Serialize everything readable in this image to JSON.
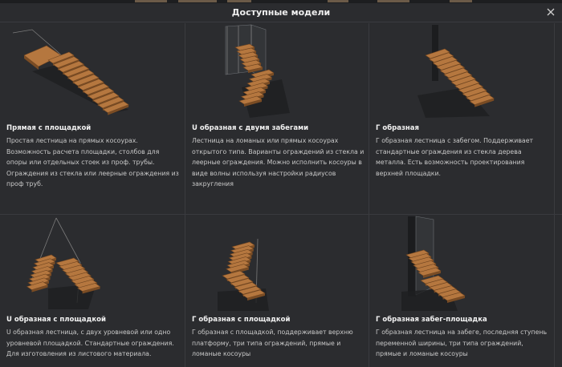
{
  "dialog": {
    "title": "Доступные модели"
  },
  "models": [
    {
      "title": "Прямая с площадкой",
      "description": "Простая лестница на прямых косоурах. Возможность расчета площадки, столбов для опоры или отдельных стоек из проф. трубы. Ограждения из стекла или леерные ограждения из проф труб."
    },
    {
      "title": "U образная с двумя забегами",
      "description": "Лестница на ломаных или прямых косоурах открытого типа. Варианты ограждений из стекла и леерные ограждения. Можно исполнить косоуры в виде волны используя настройки радиусов закругления"
    },
    {
      "title": "Г образная",
      "description": "Г образная лестница с забегом. Поддерживает стандартные ограждения из стекла дерева металла. Есть возможность проектирования верхней площадки."
    },
    {
      "title": "U образная с площадкой",
      "description": "U образная лестница, с двух уровневой или одно уровневой площадкой. Стандартные ограждения. Для изготовления из листового материала."
    },
    {
      "title": "Г образная с площадкой",
      "description": "Г образная с площадкой, поддерживает верхню платформу, три типа ограждений, прямые и ломаные косоуры"
    },
    {
      "title": "Г образная забег-площадка",
      "description": "Г образная лестница на забеге, последняя ступень переменной ширины, три типа ограждений, прямые и ломаные косоуры"
    }
  ]
}
